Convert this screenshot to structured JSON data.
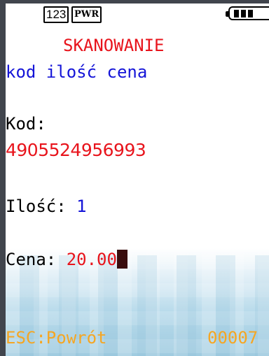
{
  "status": {
    "mode_indicator": "123",
    "power_indicator": "PWR",
    "battery_icon": "battery-full-icon"
  },
  "screen": {
    "title": "SKANOWANIE",
    "columns_hint": "kod ilość cena",
    "code_label": "Kod:",
    "code_value": "4905524956993",
    "quantity_label": "Ilość:",
    "quantity_value": "1",
    "price_label": "Cena:",
    "price_value": "20.00"
  },
  "footer": {
    "back_hint": "ESC:Powrót",
    "counter": "00007"
  },
  "colors": {
    "title": "#e8141c",
    "hint": "#1414d8",
    "footer": "#f5a623",
    "background_frame": "#41454d"
  }
}
